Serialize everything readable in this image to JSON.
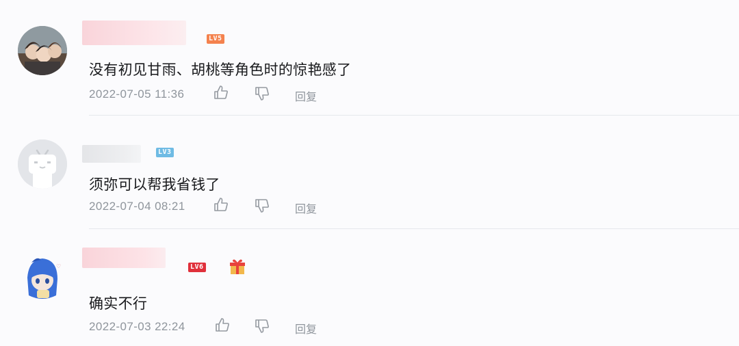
{
  "comments": [
    {
      "text": "没有初见甘雨、胡桃等角色时的惊艳感了",
      "time": "2022-07-05 11:36",
      "level": "LV5",
      "level_color": "#f4824e",
      "reply_label": "回复"
    },
    {
      "text": "须弥可以帮我省钱了",
      "time": "2022-07-04 08:21",
      "level": "LV3",
      "level_color": "#6fbbe4",
      "reply_label": "回复"
    },
    {
      "text": "确实不行",
      "time": "2022-07-03 22:24",
      "level": "LV6",
      "level_color": "#e0303b",
      "reply_label": "回复"
    }
  ],
  "icons": {
    "like": "thumbs-up-icon",
    "dislike": "thumbs-down-icon",
    "badge": "gift-box-icon"
  },
  "colors": {
    "timestamp": "#8f959c",
    "divider": "#e5e8ec"
  }
}
